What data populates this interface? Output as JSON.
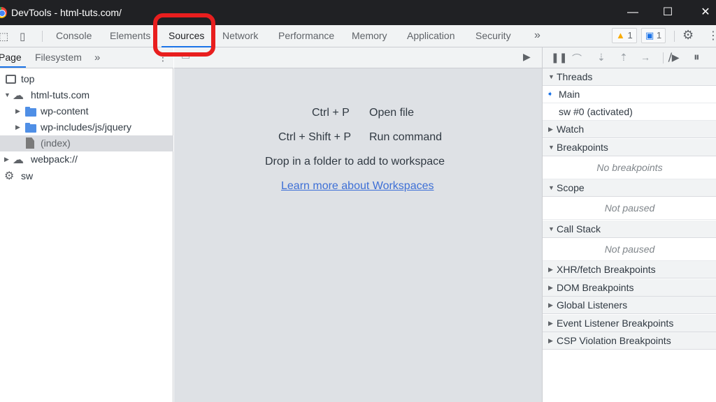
{
  "window": {
    "title": "DevTools - html-tuts.com/",
    "controls": [
      "minimize",
      "maximize",
      "close"
    ]
  },
  "toolbar": {
    "tabs": [
      {
        "label": "Console",
        "active": false
      },
      {
        "label": "Elements",
        "active": false
      },
      {
        "label": "Sources",
        "active": true
      },
      {
        "label": "Network",
        "active": false
      },
      {
        "label": "Performance",
        "active": false
      },
      {
        "label": "Memory",
        "active": false
      },
      {
        "label": "Application",
        "active": false
      },
      {
        "label": "Security",
        "active": false
      }
    ],
    "more_label": "»",
    "warnings_count": "1",
    "messages_count": "1"
  },
  "navigator": {
    "tabs": [
      {
        "label": "Page",
        "active": true
      },
      {
        "label": "Filesystem",
        "active": false
      }
    ],
    "more_label": "»",
    "tree": [
      {
        "label": "top",
        "icon": "frame-icon",
        "arrow": ""
      },
      {
        "label": "html-tuts.com",
        "icon": "cloud-icon",
        "arrow": "▼"
      },
      {
        "label": "wp-content",
        "icon": "folder-icon",
        "arrow": "▶"
      },
      {
        "label": "wp-includes/js/jquery",
        "icon": "folder-icon",
        "arrow": "▶"
      },
      {
        "label": "(index)",
        "icon": "file-icon",
        "arrow": "",
        "selected": true
      },
      {
        "label": "webpack://",
        "icon": "cloud-icon",
        "arrow": "▶"
      },
      {
        "label": "sw",
        "icon": "gear-icon",
        "arrow": ""
      }
    ]
  },
  "editor": {
    "shortcuts": [
      {
        "keys": "Ctrl + P",
        "action": "Open file"
      },
      {
        "keys": "Ctrl + Shift + P",
        "action": "Run command"
      }
    ],
    "drop_hint": "Drop in a folder to add to workspace",
    "learn_more": "Learn more about Workspaces"
  },
  "debugger": {
    "sections": {
      "threads": "Threads",
      "threads_main": "Main",
      "threads_sw": "sw #0 (activated)",
      "watch": "Watch",
      "breakpoints": "Breakpoints",
      "breakpoints_empty": "No breakpoints",
      "scope": "Scope",
      "scope_empty": "Not paused",
      "call_stack": "Call Stack",
      "call_stack_empty": "Not paused",
      "xhr": "XHR/fetch Breakpoints",
      "dom": "DOM Breakpoints",
      "global": "Global Listeners",
      "event": "Event Listener Breakpoints",
      "csp": "CSP Violation Breakpoints"
    }
  },
  "colors": {
    "accent": "#1a73e8",
    "highlight_ring": "#e81e1e"
  }
}
